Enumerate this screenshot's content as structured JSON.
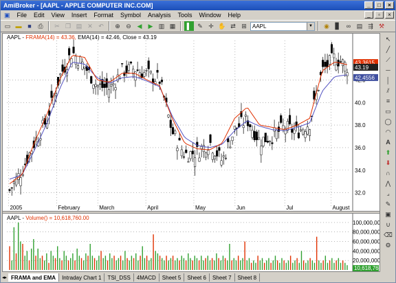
{
  "window": {
    "title": "AmiBroker - [AAPL - APPLE COMPUTER INC.COM]"
  },
  "menu": [
    "File",
    "Edit",
    "View",
    "Insert",
    "Format",
    "Symbol",
    "Analysis",
    "Tools",
    "Window",
    "Help"
  ],
  "toolbar": {
    "symbol": "AAPL"
  },
  "price_pane": {
    "header_symbol": "AAPL - ",
    "header_frama": "FRAMA(14) = 43.36, ",
    "header_ema": "EMA(14) = 42.46, Close = 43.19",
    "colors": {
      "frama": "#e03000",
      "ema": "#5050c0",
      "up": "#ffffff",
      "down": "#000000"
    }
  },
  "price_badges": [
    {
      "value": "43.3615",
      "color": "#e03000"
    },
    {
      "value": "43.19",
      "color": "#202020"
    },
    {
      "value": "42.4556",
      "color": "#4050a0"
    }
  ],
  "volume_pane": {
    "header_symbol": "AAPL - ",
    "header_volume": "Volume() = 10,618,760.00",
    "badge": "10,618,76",
    "colors": {
      "up": "#30a030",
      "down": "#e03000"
    }
  },
  "tabs": [
    "FRAMA and EMA",
    "Intraday Chart 1",
    "TSI_DSS",
    "4MACD",
    "Sheet 5",
    "Sheet 6",
    "Sheet 7",
    "Sheet 8"
  ],
  "chart_data": [
    {
      "type": "candlestick",
      "series": [
        {
          "name": "FRAMA(14)"
        },
        {
          "name": "EMA(14)"
        }
      ],
      "ylim": [
        31.0,
        45.5
      ],
      "y_ticks": [
        "32.0",
        "34.0",
        "36.0",
        "38.0",
        "40.0",
        "42.0"
      ],
      "x_ticks": [
        "2005",
        "February",
        "March",
        "April",
        "May",
        "Jun",
        "Jul",
        "August"
      ],
      "grid": true,
      "close_path": [
        32.2,
        34.0,
        36.5,
        38.5,
        42.3,
        44.5,
        43.2,
        41.5,
        41.2,
        42.8,
        43.0,
        42.5,
        42.0,
        37.4,
        35.4,
        35.6,
        36.5,
        34.8,
        37.6,
        38.5,
        36.6,
        37.0,
        37.8,
        37.4,
        38.2,
        42.8,
        44.0,
        43.19
      ],
      "frama_path": [
        32.8,
        33.6,
        36.5,
        39.0,
        42.0,
        44.2,
        44.0,
        42.0,
        41.8,
        42.6,
        42.6,
        42.0,
        41.5,
        38.6,
        36.4,
        35.9,
        35.8,
        36.4,
        38.6,
        39.6,
        38.0,
        37.8,
        37.6,
        38.0,
        38.6,
        42.8,
        43.6,
        43.36
      ],
      "ema_path": [
        33.2,
        33.6,
        35.8,
        38.2,
        41.2,
        43.6,
        43.4,
        42.2,
        41.7,
        42.2,
        42.3,
        41.9,
        41.4,
        38.8,
        36.9,
        36.2,
        36.0,
        36.3,
        37.5,
        38.4,
        37.9,
        37.6,
        37.5,
        37.8,
        38.2,
        41.0,
        42.3,
        42.46
      ]
    },
    {
      "type": "bar",
      "ylim": [
        0,
        110000000
      ],
      "y_ticks": [
        "100,000,000",
        "80,000,000",
        "60,000,000",
        "40,000,000",
        "20,000,000"
      ],
      "volumes_m": [
        50,
        20,
        90,
        35,
        100,
        60,
        55,
        30,
        40,
        20,
        45,
        65,
        30,
        45,
        25,
        30,
        20,
        35,
        15,
        40,
        30,
        25,
        50,
        25,
        20,
        40,
        30,
        20,
        25,
        35,
        20,
        45,
        30,
        25,
        20,
        35,
        30,
        55,
        30,
        25,
        20,
        30,
        40,
        25,
        30,
        20,
        35,
        25,
        30,
        20,
        25,
        30,
        20,
        40,
        25,
        20,
        30,
        25,
        35,
        20,
        30,
        50,
        25,
        30,
        20,
        25,
        75,
        40,
        35,
        30,
        25,
        20,
        30,
        20,
        25,
        30,
        20,
        25,
        20,
        30,
        25,
        20,
        35,
        25,
        20,
        30,
        25,
        20,
        30,
        20,
        25,
        30,
        20,
        25,
        20,
        35,
        25,
        20,
        30,
        25,
        20,
        55,
        20,
        25,
        20,
        30,
        20,
        25,
        60,
        20,
        25,
        15,
        20,
        15,
        30,
        20,
        25,
        15,
        20,
        25,
        15,
        20,
        30,
        20,
        15,
        25,
        20,
        15,
        20,
        30,
        15,
        20,
        25,
        15,
        40,
        20,
        15,
        20,
        25,
        20,
        15,
        70,
        20,
        15,
        20,
        30,
        15,
        20,
        25,
        15,
        20,
        25,
        15,
        20,
        15,
        10
      ]
    }
  ]
}
